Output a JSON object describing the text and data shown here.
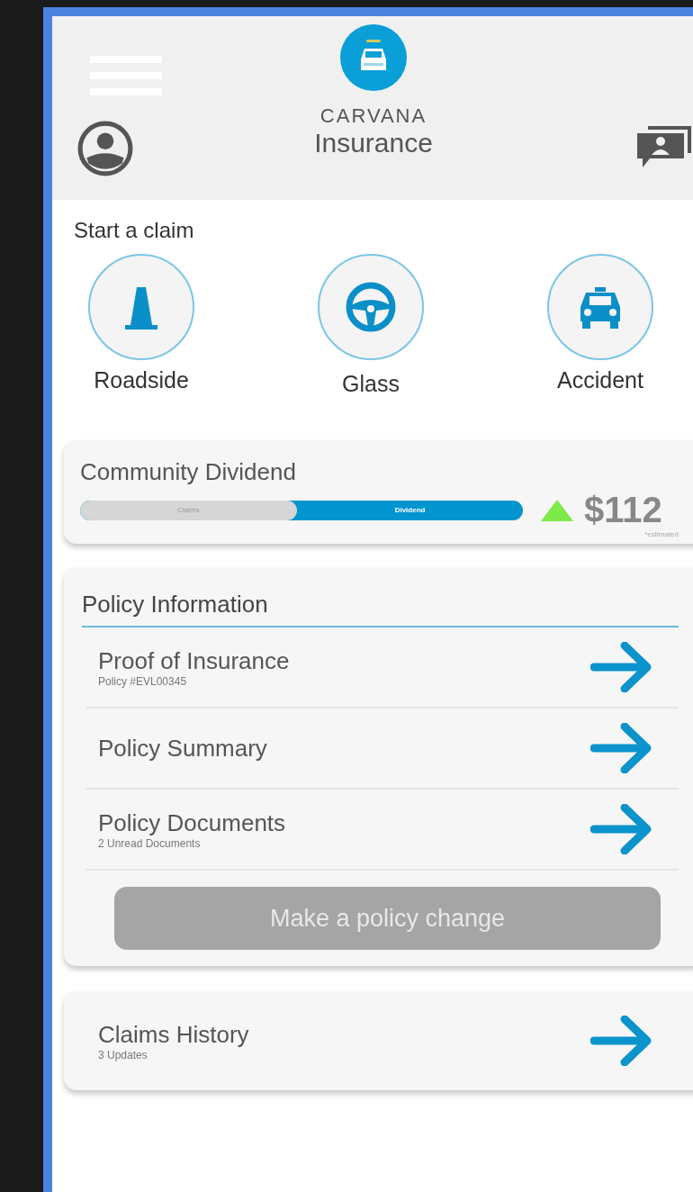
{
  "header": {
    "brand": "CARVANA",
    "title": "Insurance"
  },
  "claims": {
    "title": "Start a claim",
    "items": [
      {
        "label": "Roadside",
        "kind": "cone"
      },
      {
        "label": "Glass",
        "kind": "wheel"
      },
      {
        "label": "Accident",
        "kind": "car"
      }
    ]
  },
  "dividend": {
    "title": "Community Dividend",
    "bar": {
      "level": 0.49,
      "left_label": "Claims",
      "right_label": "Dividend"
    },
    "amount": "$112",
    "note": "*estimated"
  },
  "policy": {
    "title": "Policy Information",
    "rows": [
      {
        "title": "Proof of Insurance",
        "subtitle": "Policy #EVL00345"
      },
      {
        "title": "Policy Summary"
      },
      {
        "title": "Policy Documents",
        "subtitle": "2 Unread Documents"
      }
    ],
    "button": {
      "label": "Make a policy change",
      "disabled": true
    }
  },
  "history": {
    "title": "Claims History",
    "subtitle": "3 Updates"
  }
}
